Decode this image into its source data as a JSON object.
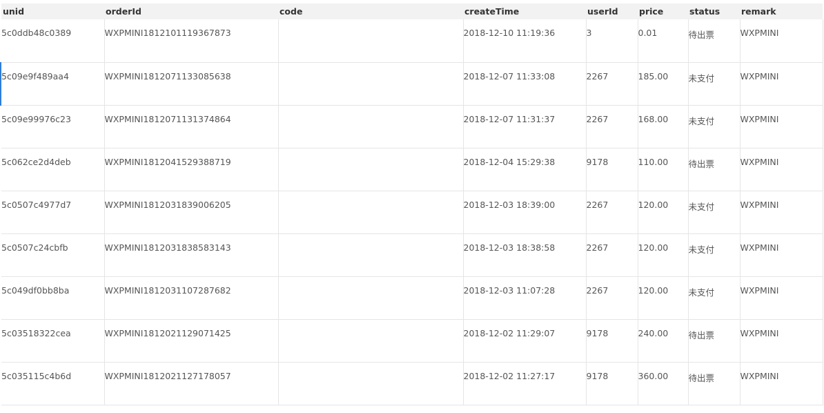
{
  "table": {
    "columns": [
      "unid",
      "orderId",
      "code",
      "createTime",
      "userId",
      "price",
      "status",
      "remark"
    ],
    "rows": [
      {
        "unid": "5c0ddb48c0389",
        "orderId": "WXPMINI1812101119367873",
        "code": "",
        "createTime": "2018-12-10 11:19:36",
        "userId": "3",
        "price": "0.01",
        "status": "待出票",
        "remark": "WXPMINI"
      },
      {
        "unid": "5c09e9f489aa4",
        "orderId": "WXPMINI1812071133085638",
        "code": "",
        "createTime": "2018-12-07 11:33:08",
        "userId": "2267",
        "price": "185.00",
        "status": "未支付",
        "remark": "WXPMINI"
      },
      {
        "unid": "5c09e99976c23",
        "orderId": "WXPMINI1812071131374864",
        "code": "",
        "createTime": "2018-12-07 11:31:37",
        "userId": "2267",
        "price": "168.00",
        "status": "未支付",
        "remark": "WXPMINI"
      },
      {
        "unid": "5c062ce2d4deb",
        "orderId": "WXPMINI1812041529388719",
        "code": "",
        "createTime": "2018-12-04 15:29:38",
        "userId": "9178",
        "price": "110.00",
        "status": "待出票",
        "remark": "WXPMINI"
      },
      {
        "unid": "5c0507c4977d7",
        "orderId": "WXPMINI1812031839006205",
        "code": "",
        "createTime": "2018-12-03 18:39:00",
        "userId": "2267",
        "price": "120.00",
        "status": "未支付",
        "remark": "WXPMINI"
      },
      {
        "unid": "5c0507c24cbfb",
        "orderId": "WXPMINI1812031838583143",
        "code": "",
        "createTime": "2018-12-03 18:38:58",
        "userId": "2267",
        "price": "120.00",
        "status": "未支付",
        "remark": "WXPMINI"
      },
      {
        "unid": "5c049df0bb8ba",
        "orderId": "WXPMINI1812031107287682",
        "code": "",
        "createTime": "2018-12-03 11:07:28",
        "userId": "2267",
        "price": "120.00",
        "status": "未支付",
        "remark": "WXPMINI"
      },
      {
        "unid": "5c03518322cea",
        "orderId": "WXPMINI1812021129071425",
        "code": "",
        "createTime": "2018-12-02 11:29:07",
        "userId": "9178",
        "price": "240.00",
        "status": "待出票",
        "remark": "WXPMINI"
      },
      {
        "unid": "5c035115c4b6d",
        "orderId": "WXPMINI1812021127178057",
        "code": "",
        "createTime": "2018-12-02 11:27:17",
        "userId": "9178",
        "price": "360.00",
        "status": "待出票",
        "remark": "WXPMINI"
      }
    ]
  }
}
